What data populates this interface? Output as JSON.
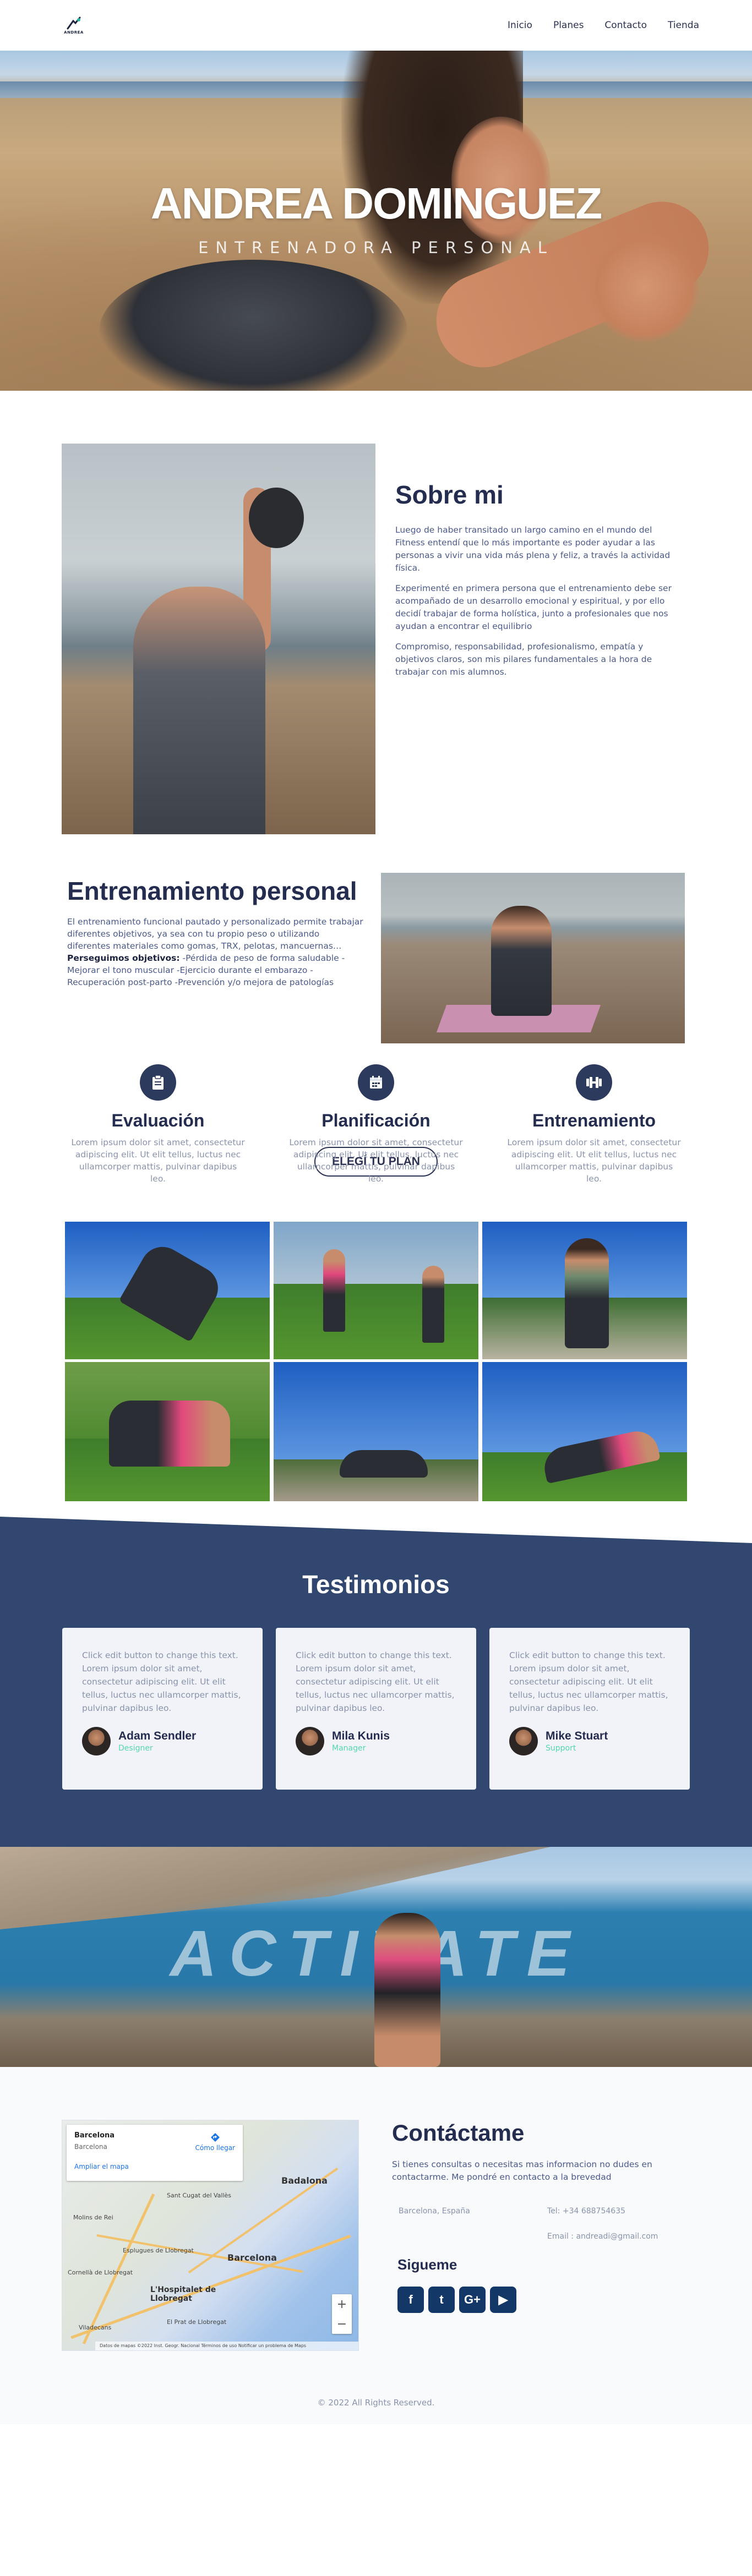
{
  "header": {
    "logo_text": "ANDREA",
    "nav": [
      "Inicio",
      "Planes",
      "Contacto",
      "Tienda"
    ]
  },
  "hero": {
    "title": "ANDREA DOMINGUEZ",
    "subtitle": "ENTRENADORA PERSONAL"
  },
  "about": {
    "title": "Sobre mi",
    "paragraphs": [
      "Luego de haber transitado un largo camino en el mundo del Fitness entendí que lo más importante es poder ayudar a las personas a vivir una vida más plena y feliz, a través la actividad física.",
      "Experimenté en primera persona que el entrenamiento debe ser acompañado de un desarrollo emocional y espiritual, y por ello decidí trabajar de forma holística, junto a profesionales que nos ayudan a encontrar el equilibrio",
      "Compromiso, responsabilidad, profesionalismo, empatía y objetivos claros, son mis pilares fundamentales a la hora de trabajar con mis alumnos."
    ]
  },
  "training": {
    "title": "Entrenamiento personal",
    "desc_before": "El entrenamiento funcional pautado y personalizado permite trabajar diferentes objetivos, ya sea con tu propio peso o utilizando diferentes materiales como gomas, TRX, pelotas, mancuernas…",
    "desc_bold": "Perseguimos objetivos:",
    "desc_after": " -Pérdida de peso de forma saludable -Mejorar el tono muscular -Ejercicio durante el embarazo -Recuperación post-parto -Prevención y/o mejora de patologías"
  },
  "services": [
    {
      "icon": "clipboard-icon",
      "title": "Evaluación",
      "text": "Lorem ipsum dolor sit amet, consectetur adipiscing elit. Ut elit tellus, luctus nec ullamcorper mattis, pulvinar dapibus leo."
    },
    {
      "icon": "calendar-icon",
      "title": "Planificación",
      "text": "Lorem ipsum dolor sit amet, consectetur adipiscing elit. Ut elit tellus, luctus nec ullamcorper mattis, pulvinar dapibus leo."
    },
    {
      "icon": "dumbbell-icon",
      "title": "Entrenamiento",
      "text": "Lorem ipsum dolor sit amet, consectetur adipiscing elit. Ut elit tellus, luctus nec ullamcorper mattis, pulvinar dapibus leo."
    }
  ],
  "cta": {
    "label": "ELEGÍ TU PLAN"
  },
  "testimonials": {
    "title": "Testimonios",
    "items": [
      {
        "text": "Click edit button to change this text. Lorem ipsum dolor sit amet, consectetur adipiscing elit. Ut elit tellus, luctus nec ullamcorper mattis, pulvinar dapibus leo.",
        "name": "Adam Sendler",
        "role": "Designer"
      },
      {
        "text": "Click edit button to change this text. Lorem ipsum dolor sit amet, consectetur adipiscing elit. Ut elit tellus, luctus nec ullamcorper mattis, pulvinar dapibus leo.",
        "name": "Mila Kunis",
        "role": "Manager"
      },
      {
        "text": "Click edit button to change this text. Lorem ipsum dolor sit amet, consectetur adipiscing elit. Ut elit tellus, luctus nec ullamcorper mattis, pulvinar dapibus leo.",
        "name": "Mike Stuart",
        "role": "Support"
      }
    ]
  },
  "activate": {
    "word": "ACTIVATE"
  },
  "map": {
    "place": "Barcelona",
    "place_sub": "Barcelona",
    "directions": "Cómo llegar",
    "larger_map": "Ampliar el mapa",
    "cities": [
      "Badalona",
      "Barcelona",
      "L'Hospitalet de Llobregat",
      "Molins de Rei",
      "Sant Cugat del Vallès",
      "Esplugues de Llobregat",
      "Cornellà de Llobregat",
      "Viladecans",
      "El Prat de Llobregat"
    ],
    "zoom_in": "+",
    "zoom_out": "−",
    "attribution": "Datos de mapas ©2022 Inst. Geogr. Nacional   Términos de uso   Notificar un problema de Maps"
  },
  "contact": {
    "title": "Contáctame",
    "desc": "Si tienes consultas o necesitas mas informacion no dudes en contactarme. Me pondré en contacto a la brevedad",
    "location": "Barcelona, España",
    "phone": "Tel: +34 688754635",
    "email": "Email : andreadi@gmail.com",
    "follow": "Sigueme",
    "socials": [
      {
        "icon": "facebook-icon",
        "glyph": "f"
      },
      {
        "icon": "twitter-icon",
        "glyph": "t"
      },
      {
        "icon": "google-plus-icon",
        "glyph": "G+"
      },
      {
        "icon": "youtube-icon",
        "glyph": "▶"
      }
    ]
  },
  "footer": {
    "text": "© 2022 All Rights Reserved."
  },
  "colors": {
    "primary": "#242c4f",
    "band": "#31476f",
    "accent": "#54d6b2",
    "social": "#133767"
  }
}
